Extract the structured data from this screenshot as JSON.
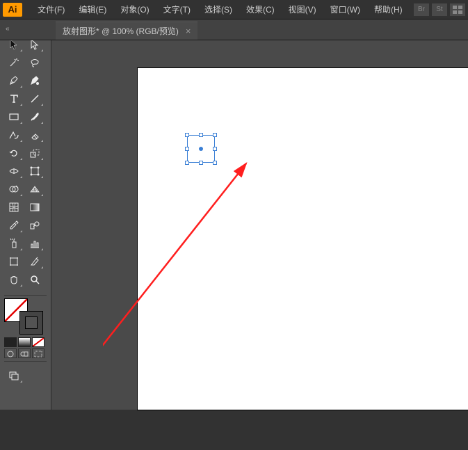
{
  "app": {
    "logo": "Ai"
  },
  "menu": {
    "file": "文件(F)",
    "edit": "编辑(E)",
    "object": "对象(O)",
    "type": "文字(T)",
    "select": "选择(S)",
    "effect": "效果(C)",
    "view": "视图(V)",
    "window": "窗口(W)",
    "help": "帮助(H)"
  },
  "menu_right": {
    "br": "Br",
    "st": "St"
  },
  "tabbar": {
    "expand": "«"
  },
  "doc_tab": {
    "title": "放射图形* @ 100% (RGB/预览)",
    "close": "×"
  },
  "ruler": {
    "guide": "« ‹"
  }
}
